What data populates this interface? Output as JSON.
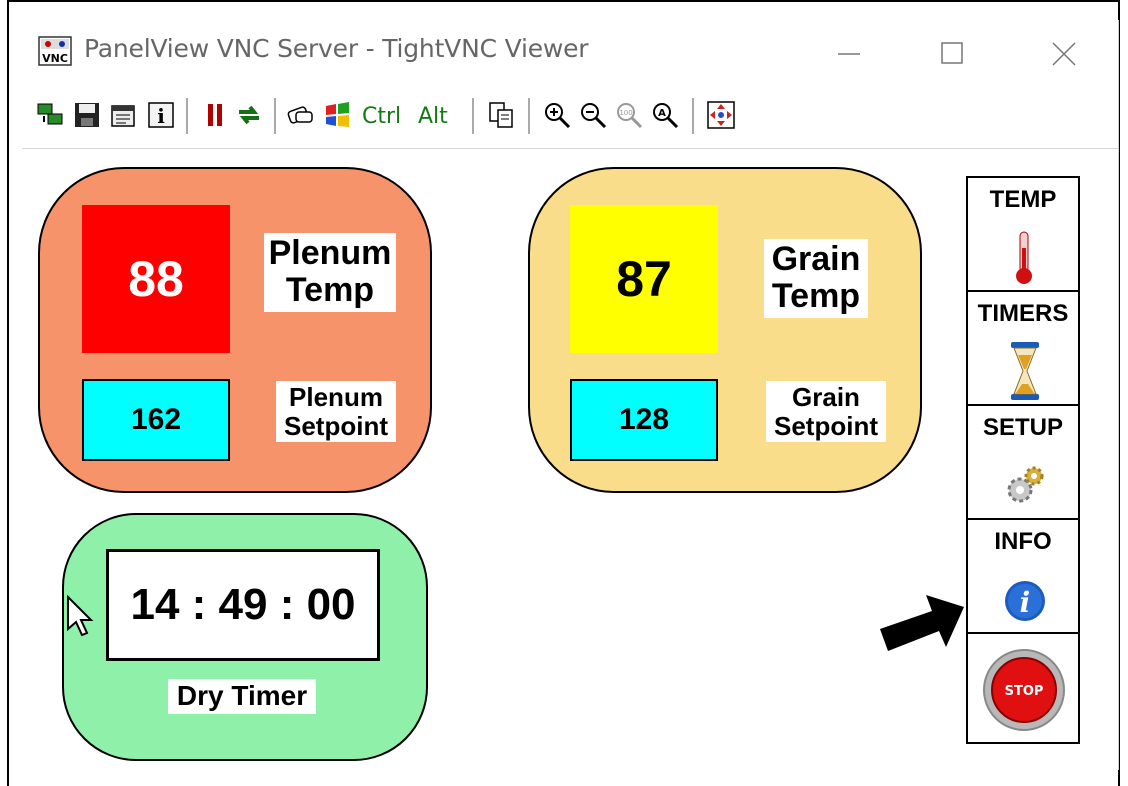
{
  "window": {
    "title": "PanelView VNC Server - TightVNC Viewer",
    "minimize_glyph": "—",
    "maximize_glyph": "☐",
    "close_glyph": "✕"
  },
  "toolbar": {
    "ctrl_label": "Ctrl",
    "alt_label": "Alt",
    "icons": [
      "new-connection-icon",
      "save-icon",
      "options-icon",
      "info-icon",
      "pause-icon",
      "refresh-icon",
      "send-ctrl-alt-del-icon",
      "send-win-key-icon",
      "ctrl-key-icon",
      "alt-key-icon",
      "clipboard-icon",
      "zoom-in-icon",
      "zoom-out-icon",
      "zoom-100-icon",
      "zoom-auto-icon",
      "fullscreen-icon"
    ]
  },
  "plenum": {
    "value": "88",
    "label_line1": "Plenum",
    "label_line2": "Temp",
    "setpoint": "162",
    "setpoint_label_line1": "Plenum",
    "setpoint_label_line2": "Setpoint",
    "color": "#f7936a",
    "value_color": "#ff0000"
  },
  "grain": {
    "value": "87",
    "label_line1": "Grain",
    "label_line2": "Temp",
    "setpoint": "128",
    "setpoint_label_line1": "Grain",
    "setpoint_label_line2": "Setpoint",
    "color": "#fadd8b",
    "value_color": "#ffff00"
  },
  "timer": {
    "value": "14 : 49 : 00",
    "label": "Dry Timer",
    "color": "#8ff0aa"
  },
  "nav": {
    "temp_label": "TEMP",
    "timers_label": "TIMERS",
    "setup_label": "SETUP",
    "info_label": "INFO",
    "stop_label": "STOP"
  },
  "setpoint_color": "#00ffff"
}
